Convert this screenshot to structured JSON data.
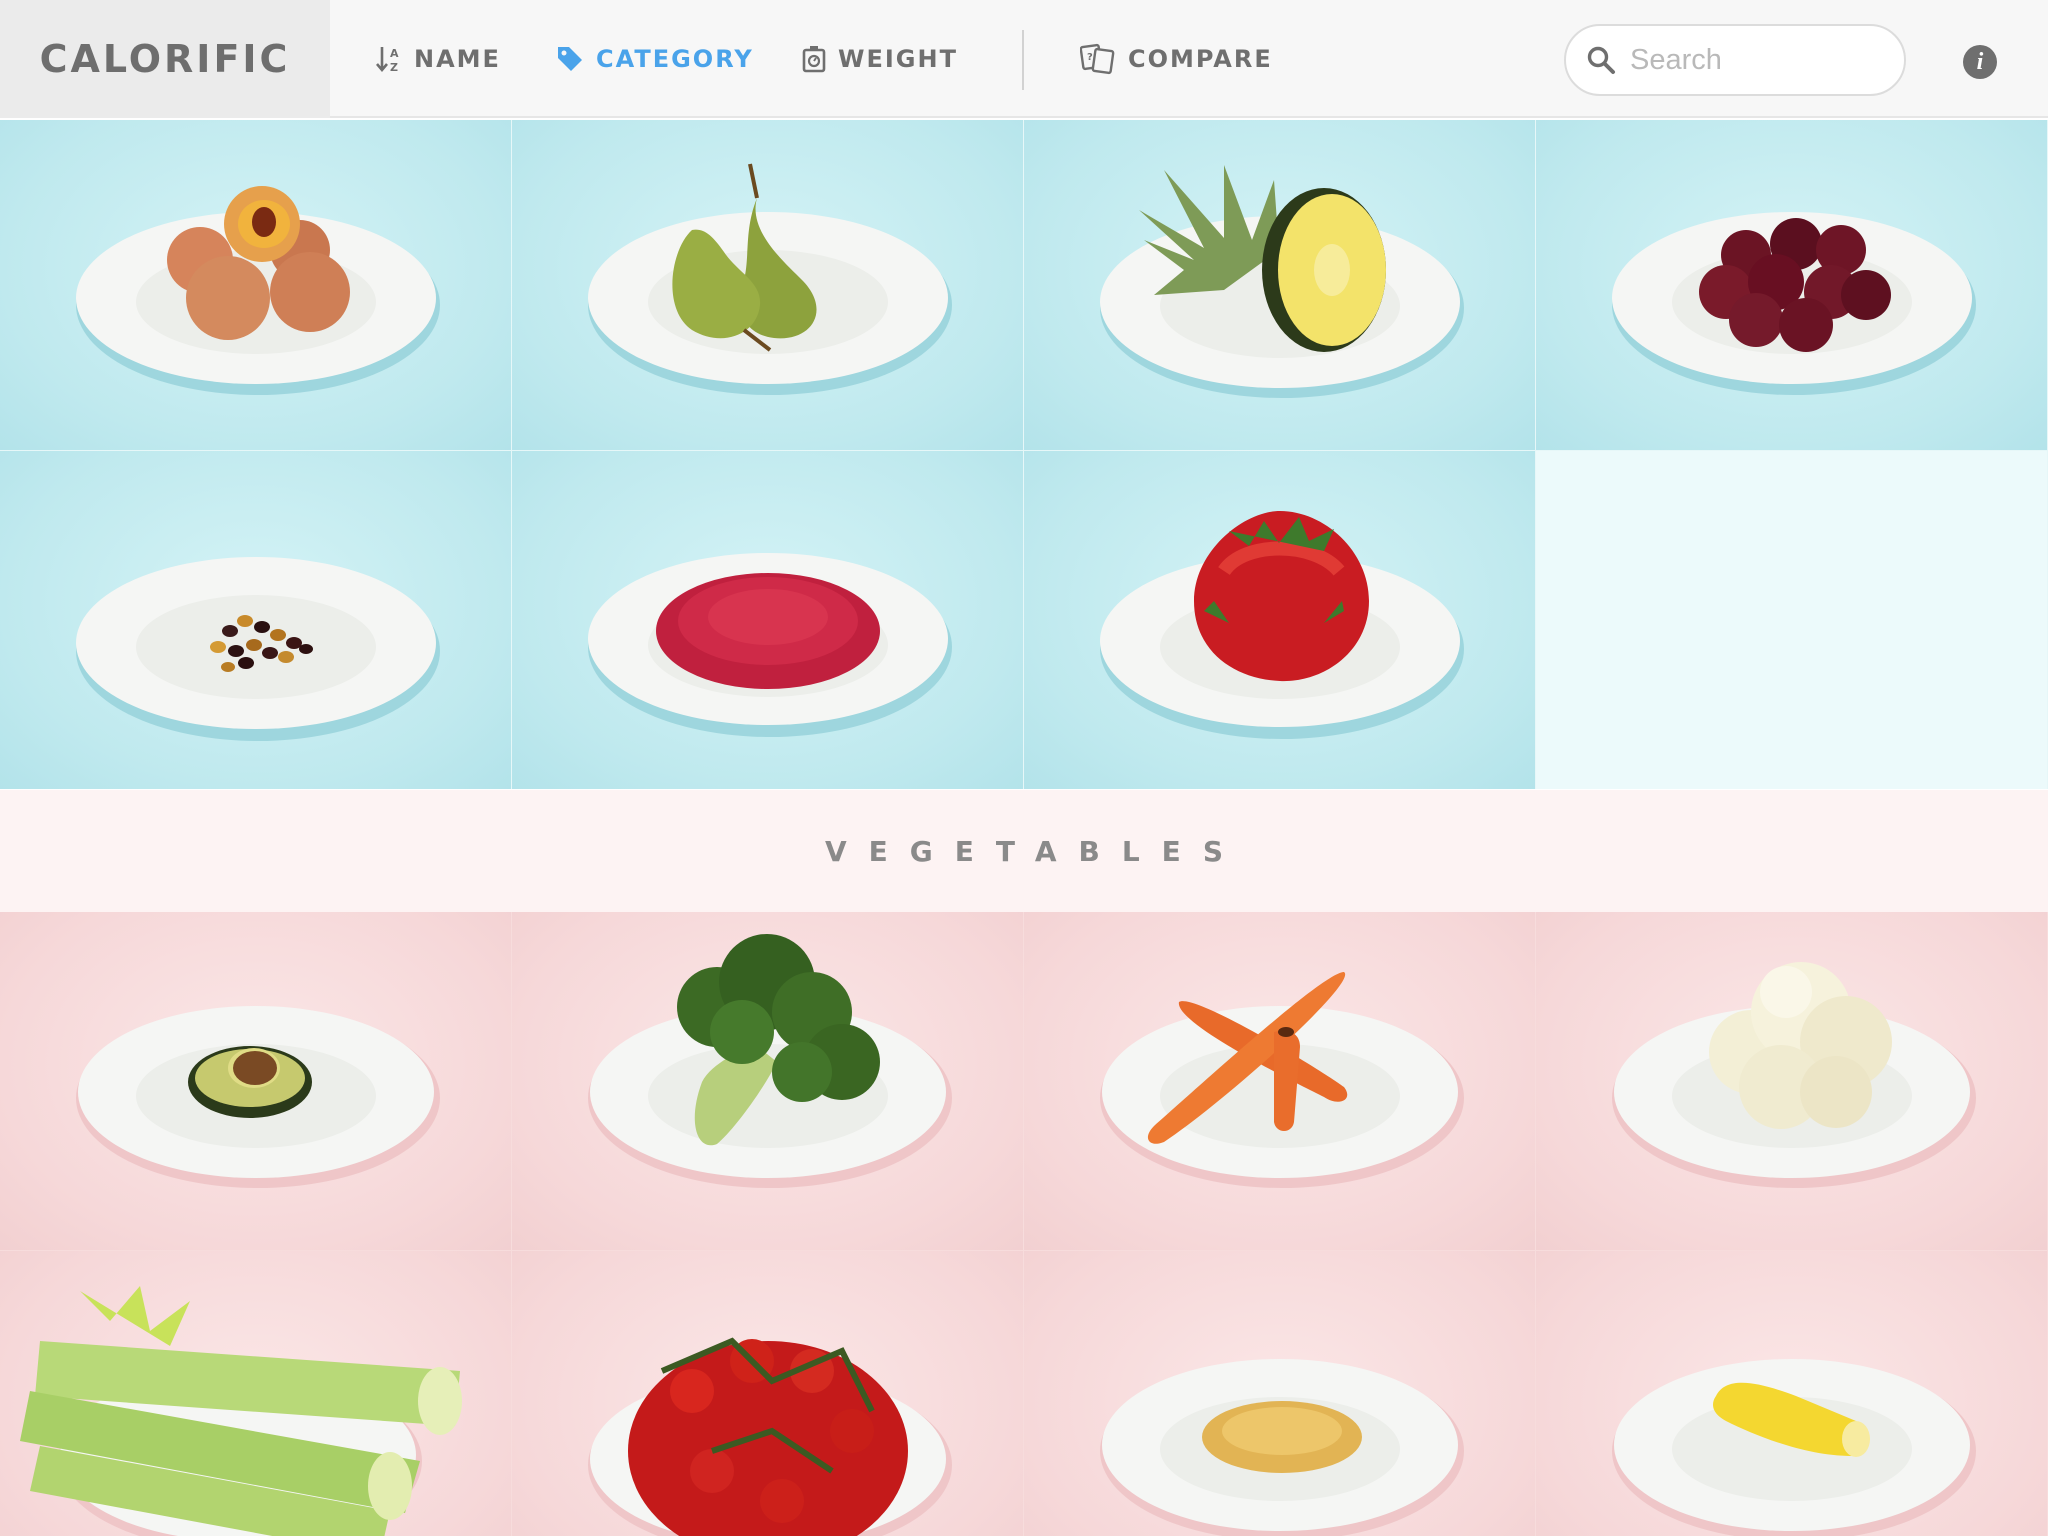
{
  "app": {
    "title": "CALORIFIC"
  },
  "nav": {
    "items": [
      {
        "label": "NAME",
        "icon": "sort-az-icon",
        "active": false
      },
      {
        "label": "CATEGORY",
        "icon": "tag-icon",
        "active": true
      },
      {
        "label": "WEIGHT",
        "icon": "scale-icon",
        "active": false
      },
      {
        "label": "COMPARE",
        "icon": "compare-icon",
        "active": false
      }
    ],
    "active_color": "#4aa3ea",
    "inactive_color": "#6f6f6f"
  },
  "search": {
    "placeholder": "Search",
    "value": "",
    "icon": "search-icon"
  },
  "info": {
    "label": "i",
    "icon": "info-icon"
  },
  "sections": [
    {
      "category": "fruits",
      "items": [
        "peaches",
        "pears",
        "pineapple",
        "plums",
        "raisins",
        "raspberries",
        "strawberries"
      ]
    },
    {
      "category": "vegetables",
      "header": "VEGETABLES",
      "items": [
        "avocado",
        "broccoli",
        "carrots",
        "cauliflower",
        "celery",
        "cherry-tomatoes",
        "chickpeas",
        "sweetcorn"
      ]
    }
  ],
  "colors": {
    "fruit_bg": "#c6ecf0",
    "vegetable_bg": "#f7dcdd",
    "plate": "#f5f6f4"
  }
}
